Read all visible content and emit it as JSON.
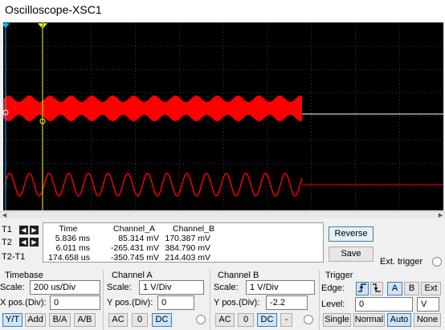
{
  "window": {
    "title": "Oscilloscope-XSC1"
  },
  "cursors": {
    "marker_t1": "1",
    "marker_t2": "2",
    "labels": [
      "T1",
      "T2",
      "T2-T1"
    ]
  },
  "measurements": {
    "headers": [
      "Time",
      "Channel_A",
      "Channel_B"
    ],
    "rows": [
      [
        "5.836 ms",
        "85.314 mV",
        "170.387 mV"
      ],
      [
        "6.011 ms",
        "-265.431 mV",
        "384.790 mV"
      ],
      [
        "174.658 us",
        "-350.745 mV",
        "214.403 mV"
      ]
    ]
  },
  "actions": {
    "reverse": "Reverse",
    "save": "Save",
    "ext_trigger": "Ext. trigger"
  },
  "timebase": {
    "title": "Timebase",
    "scale_label": "Scale:",
    "scale_value": "200 us/Div",
    "xpos_label": "X pos.(Div):",
    "xpos_value": "0",
    "modes": [
      "Y/T",
      "Add",
      "B/A",
      "A/B"
    ]
  },
  "channel_a": {
    "title": "Channel A",
    "scale_label": "Scale:",
    "scale_value": "1  V/Div",
    "ypos_label": "Y pos.(Div):",
    "ypos_value": "0",
    "coupling": [
      "AC",
      "0",
      "DC"
    ]
  },
  "channel_b": {
    "title": "Channel B",
    "scale_label": "Scale:",
    "scale_value": "1  V/Div",
    "ypos_label": "Y pos.(Div):",
    "ypos_value": "-2.2",
    "coupling": [
      "AC",
      "0",
      "DC",
      "-"
    ]
  },
  "trigger": {
    "title": "Trigger",
    "edge_label": "Edge:",
    "edge_sources": [
      "A",
      "B",
      "Ext"
    ],
    "level_label": "Level:",
    "level_value": "0",
    "level_unit": "V",
    "modes": [
      "Single",
      "Normal",
      "Auto",
      "None"
    ]
  },
  "colors": {
    "trace": "#ff0000",
    "cursor1": "#00bfff",
    "cursor2": "#ffff00",
    "grid": "#6a6a6a"
  },
  "icons": {
    "left_arrow": "left-arrow-icon",
    "right_arrow": "right-arrow-icon",
    "rising_edge": "rising-edge-icon",
    "falling_edge": "falling-edge-icon"
  }
}
